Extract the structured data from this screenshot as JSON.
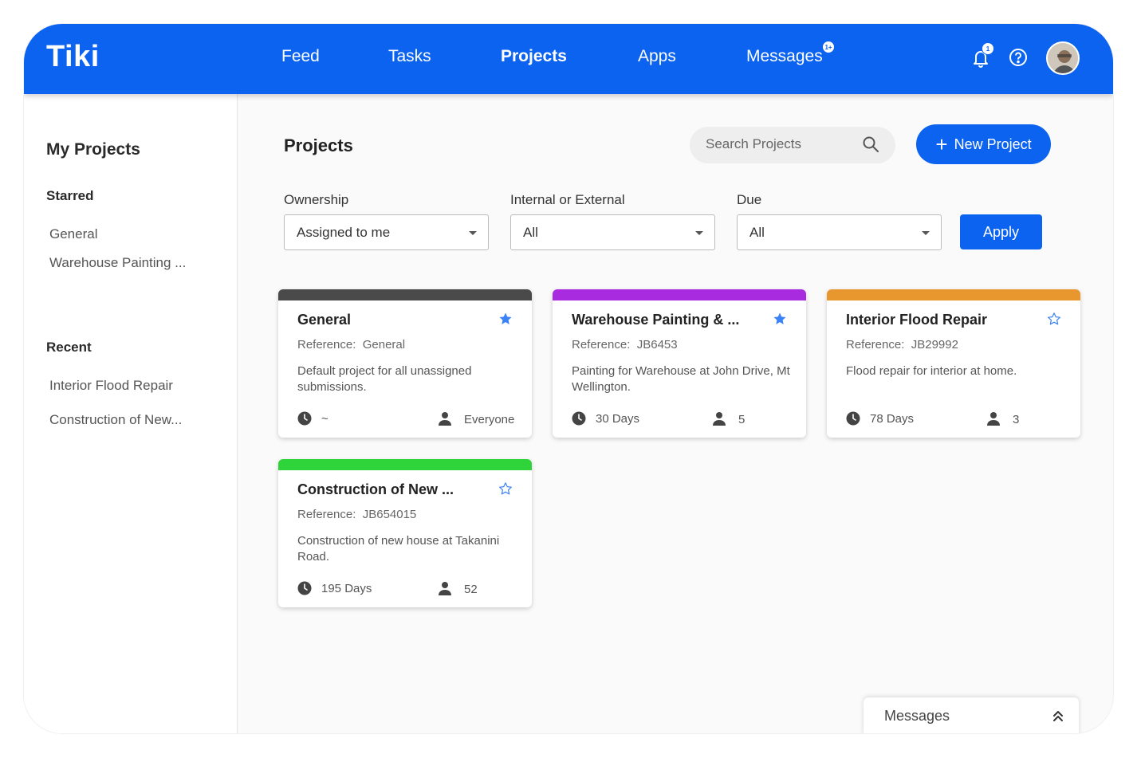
{
  "app": {
    "logo": "Tiki"
  },
  "nav": {
    "items": [
      {
        "label": "Feed",
        "active": false
      },
      {
        "label": "Tasks",
        "active": false
      },
      {
        "label": "Projects",
        "active": true
      },
      {
        "label": "Apps",
        "active": false
      },
      {
        "label": "Messages",
        "active": false,
        "badge": "1+"
      }
    ],
    "notifications_badge": "1",
    "icons": [
      "bell-icon",
      "help-icon",
      "avatar"
    ]
  },
  "sidebar": {
    "title": "My Projects",
    "starred_heading": "Starred",
    "starred": [
      "General",
      "Warehouse Painting ..."
    ],
    "recent_heading": "Recent",
    "recent": [
      "Interior Flood Repair",
      "Construction of New..."
    ]
  },
  "main": {
    "title": "Projects",
    "search": {
      "placeholder": "Search Projects",
      "value": ""
    },
    "new_project_label": "New Project",
    "filters": [
      {
        "label": "Ownership",
        "value": "Assigned to me"
      },
      {
        "label": "Internal or External",
        "value": "All"
      },
      {
        "label": "Due",
        "value": "All"
      }
    ],
    "apply_label": "Apply",
    "cards": [
      {
        "title": "General",
        "starred": true,
        "color": "#4a4a4a",
        "reference_label": "Reference:",
        "reference": "General",
        "description": "Default project for all unassigned submissions.",
        "due": "~",
        "members": "Everyone"
      },
      {
        "title": "Warehouse Painting & ...",
        "starred": true,
        "color": "#a92be0",
        "reference_label": "Reference:",
        "reference": "JB6453",
        "description": "Painting for Warehouse at John Drive, Mt Wellington.",
        "due": "30 Days",
        "members": "5"
      },
      {
        "title": "Interior Flood Repair",
        "starred": false,
        "color": "#e8962e",
        "reference_label": "Reference:",
        "reference": "JB29992",
        "description": "Flood repair for interior at home.",
        "due": "78 Days",
        "members": "3"
      },
      {
        "title": "Construction of New ...",
        "starred": false,
        "color": "#2ed43a",
        "reference_label": "Reference:",
        "reference": "JB654015",
        "description": "Construction of new house at Takanini Road.",
        "due": "195 Days",
        "members": "52"
      }
    ]
  },
  "messages_panel": {
    "label": "Messages"
  },
  "colors": {
    "brand": "#0b63f0",
    "star": "#3b82f6"
  }
}
